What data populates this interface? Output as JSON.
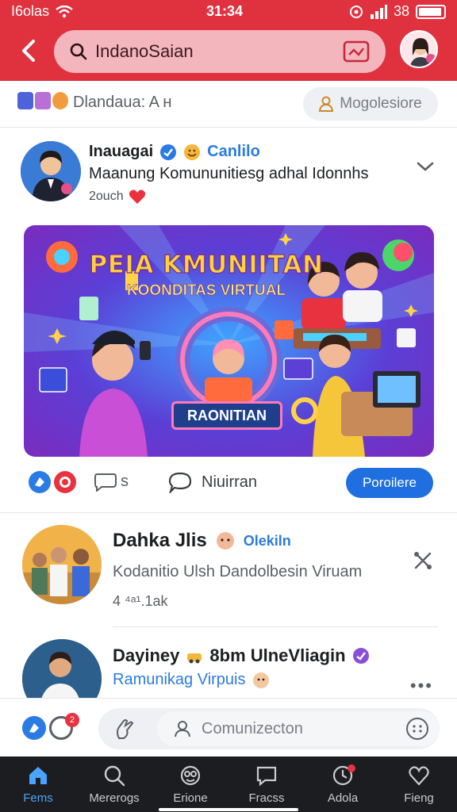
{
  "status_bar": {
    "carrier": "I6olas",
    "time": "31:34",
    "battery": "38"
  },
  "header": {
    "back_icon": "back-arrow-icon",
    "search_text": "IndanoSaian",
    "search_icon": "search-icon",
    "camera_icon": "camera-icon",
    "accent": "#e0313f"
  },
  "community": {
    "label": "Dlandaua: A ʜ",
    "members_button": "Mogolesiore"
  },
  "post1": {
    "author": "Inauagai",
    "tag": "Canlilo",
    "text": "Maanung Komununitiesg adhal Idonnhs",
    "time": "2ouch",
    "banner": {
      "title": "PEIA KMUNIITAN",
      "subtitle": "KOONDITAS VIRTUAL",
      "sign": "RAONITIAN"
    },
    "comment_count": "s",
    "comment_label": "Niuirran",
    "share_label": "Poroilere"
  },
  "post2": {
    "author": "Dahka Jlis",
    "tag": "Olekiln",
    "text": "Kodanitio Ulsh Dandolbesin Viruam",
    "meta": "4 ⁴ᵃ¹.1ak"
  },
  "post3": {
    "author": "Dayiney",
    "title": "8bm UlneVliagin",
    "text": "Ramunikag Virpuis"
  },
  "composer": {
    "badge": "2",
    "placeholder": "Comunizecton"
  },
  "nav": [
    {
      "label": "Fems",
      "icon": "home-icon"
    },
    {
      "label": "Mererogs",
      "icon": "search-icon"
    },
    {
      "label": "Erione",
      "icon": "globe-icon"
    },
    {
      "label": "Fracss",
      "icon": "chat-icon"
    },
    {
      "label": "Adola",
      "icon": "clock-icon"
    },
    {
      "label": "Fieng",
      "icon": "heart-icon"
    }
  ]
}
